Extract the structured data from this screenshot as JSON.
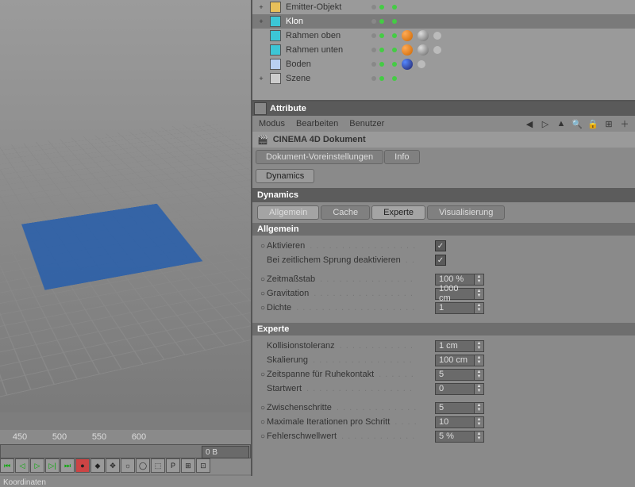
{
  "viewport": {
    "ruler": [
      "450",
      "500",
      "550",
      "600"
    ],
    "timeline_field": "0 B"
  },
  "status": "Koordinaten",
  "objects": [
    {
      "name": "Emitter-Objekt",
      "expand": "+",
      "icon": "particle",
      "tags": []
    },
    {
      "name": "Klon",
      "expand": "+",
      "icon": "cube",
      "sel": true,
      "tags": []
    },
    {
      "name": "Rahmen oben",
      "expand": "",
      "icon": "cube",
      "tags": [
        "orange",
        "grey",
        "sm"
      ]
    },
    {
      "name": "Rahmen unten",
      "expand": "",
      "icon": "cube",
      "tags": [
        "orange",
        "grey",
        "sm"
      ]
    },
    {
      "name": "Boden",
      "expand": "",
      "icon": "floor",
      "tags": [
        "blue",
        "sm"
      ]
    },
    {
      "name": "Szene",
      "expand": "+",
      "icon": "scene",
      "tags": []
    }
  ],
  "attribute_title": "Attribute",
  "attr_menu": [
    "Modus",
    "Bearbeiten",
    "Benutzer"
  ],
  "doc_label": "CINEMA 4D Dokument",
  "tabs1": [
    {
      "l": "Dokument-Voreinstellungen",
      "a": false
    },
    {
      "l": "Info",
      "a": false
    }
  ],
  "tabs2": [
    {
      "l": "Dynamics",
      "a": true
    }
  ],
  "section": "Dynamics",
  "subtabs": [
    {
      "l": "Allgemein",
      "a": false,
      "blank": true
    },
    {
      "l": "Cache",
      "a": false
    },
    {
      "l": "Experte",
      "a": true,
      "blank": true
    },
    {
      "l": "Visualisierung",
      "a": false
    }
  ],
  "group_allgemein": "Allgemein",
  "allgemein": [
    {
      "ck": "○",
      "label": "Aktivieren",
      "type": "check",
      "on": true
    },
    {
      "ck": "",
      "label": "Bei zeitlichem Sprung deaktivieren",
      "type": "check",
      "on": true
    },
    {
      "ck": "○",
      "label": "Zeitmaßstab",
      "type": "num",
      "val": "100 %"
    },
    {
      "ck": "○",
      "label": "Gravitation",
      "type": "num",
      "val": "1000 cm"
    },
    {
      "ck": "○",
      "label": "Dichte",
      "type": "num",
      "val": "1"
    }
  ],
  "group_experte": "Experte",
  "experte": [
    {
      "ck": "",
      "label": "Kollisionstoleranz",
      "type": "num",
      "val": "1 cm"
    },
    {
      "ck": "",
      "label": "Skalierung",
      "type": "num",
      "val": "100 cm"
    },
    {
      "ck": "○",
      "label": "Zeitspanne für Ruhekontakt",
      "type": "num",
      "val": "5"
    },
    {
      "ck": "",
      "label": "Startwert",
      "type": "num",
      "val": "0"
    },
    {
      "ck": "○",
      "label": "Zwischenschritte",
      "type": "num",
      "val": "5"
    },
    {
      "ck": "○",
      "label": "Maximale Iterationen pro Schritt",
      "type": "num",
      "val": "10"
    },
    {
      "ck": "○",
      "label": "Fehlerschwellwert",
      "type": "num",
      "val": "5 %"
    }
  ],
  "chart_data": null
}
